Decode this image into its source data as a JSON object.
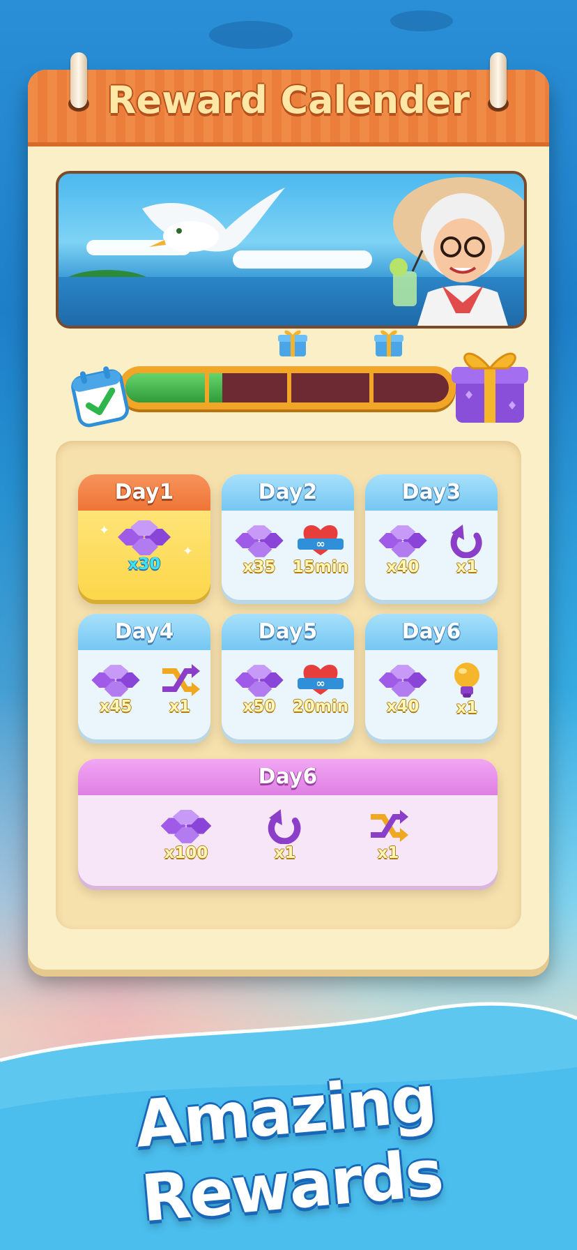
{
  "header": {
    "title": "Reward Calender"
  },
  "progress": {
    "fraction": 0.3
  },
  "days": [
    {
      "label": "Day1",
      "rewards": [
        {
          "icon": "gem-pile-icon",
          "qty": "x30"
        }
      ],
      "active": true
    },
    {
      "label": "Day2",
      "rewards": [
        {
          "icon": "gem-pile-icon",
          "qty": "x35"
        },
        {
          "icon": "infinite-heart-icon",
          "qty": "15min"
        }
      ]
    },
    {
      "label": "Day3",
      "rewards": [
        {
          "icon": "gem-pile-icon",
          "qty": "x40"
        },
        {
          "icon": "undo-arrow-icon",
          "qty": "x1"
        }
      ]
    },
    {
      "label": "Day4",
      "rewards": [
        {
          "icon": "gem-pile-icon",
          "qty": "x45"
        },
        {
          "icon": "shuffle-icon",
          "qty": "x1"
        }
      ]
    },
    {
      "label": "Day5",
      "rewards": [
        {
          "icon": "gem-pile-icon",
          "qty": "x50"
        },
        {
          "icon": "infinite-heart-icon",
          "qty": "20min"
        }
      ]
    },
    {
      "label": "Day6",
      "rewards": [
        {
          "icon": "gem-pile-icon",
          "qty": "x40"
        },
        {
          "icon": "lightbulb-icon",
          "qty": "x1"
        }
      ]
    }
  ],
  "final_day": {
    "label": "Day6",
    "rewards": [
      {
        "icon": "gem-pile-icon",
        "qty": "x100"
      },
      {
        "icon": "undo-arrow-icon",
        "qty": "x1"
      },
      {
        "icon": "shuffle-icon",
        "qty": "x1"
      }
    ]
  },
  "tagline": "Amazing Rewards",
  "colors": {
    "header": "#f08a47",
    "panel": "#fbefc8",
    "active_card": "#fcd74a",
    "final_card": "#df7fe3",
    "progress_fill": "#2f9b3a"
  }
}
